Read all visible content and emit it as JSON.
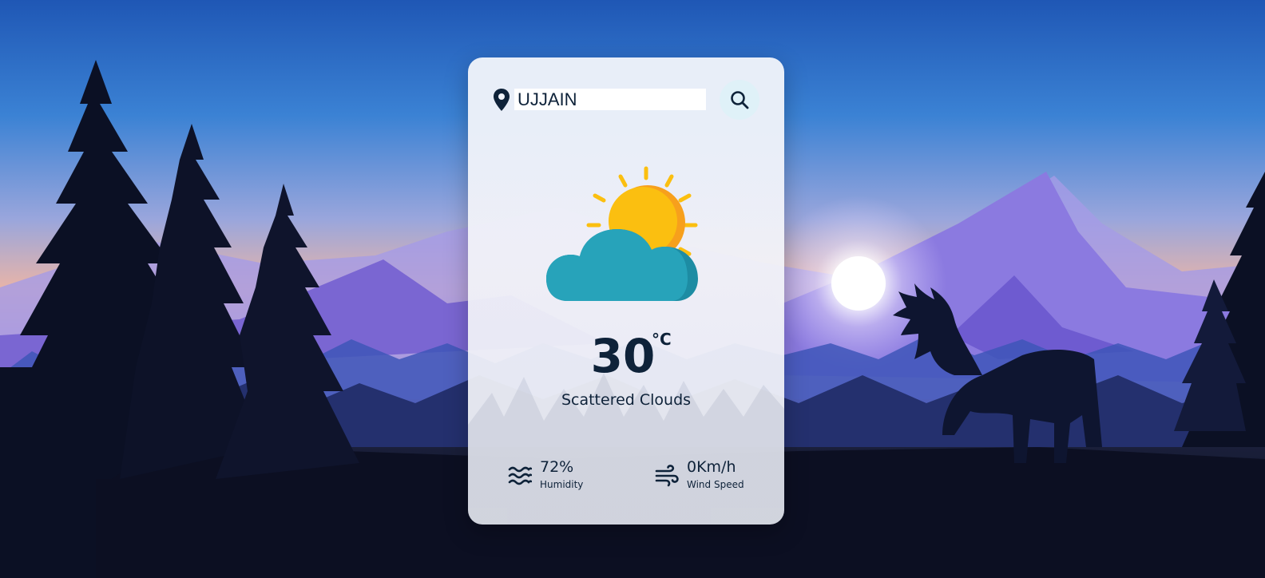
{
  "search": {
    "value": "UJJAIN",
    "location_icon": "map-pin-icon",
    "button_icon": "search-icon"
  },
  "weather": {
    "icon": "partly-cloudy-sun-icon",
    "temperature": "30",
    "unit": "°C",
    "description": "Scattered Clouds"
  },
  "stats": {
    "humidity": {
      "icon": "humidity-waves-icon",
      "value": "72%",
      "label": "Humidity"
    },
    "wind": {
      "icon": "wind-icon",
      "value": "0Km/h",
      "label": "Wind Speed"
    }
  },
  "colors": {
    "text": "#0e2239",
    "card": "#f0f3fa",
    "search_button": "#dff1f8",
    "sun": "#fbbf10",
    "sun_shade": "#f7a01c",
    "cloud": "#27a3ba",
    "cloud_shade": "#1d8ca3"
  }
}
